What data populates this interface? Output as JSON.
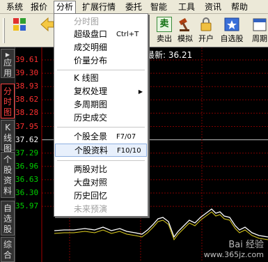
{
  "menubar": {
    "items": [
      "系统",
      "报价",
      "分析",
      "扩展行情",
      "委托",
      "智能",
      "工具",
      "资讯",
      "帮助"
    ]
  },
  "toolbar": {
    "sell_label": "卖出",
    "simulate_label": "模拟",
    "open_account_label": "开户",
    "watchlist_label": "自选股",
    "partial_label": "周期",
    "buy_glyph": "卖"
  },
  "sidetabs": {
    "apps": "应用",
    "timeshare": "分时图",
    "kline": "K线图",
    "stock_info": "个股资料",
    "watchlist": "自选股",
    "composite": "综合"
  },
  "chart": {
    "latest_text": "最新: 36.21",
    "prices": [
      "39.61",
      "39.30",
      "38.93",
      "38.62",
      "38.28",
      "37.95",
      "37.62",
      "37.29",
      "36.96",
      "36.63",
      "36.30",
      "35.97"
    ],
    "prev_close": "37.62",
    "colors": {
      "up": "#ff3030",
      "flat": "#ffffff",
      "down": "#00d000",
      "grid": "#800000"
    }
  },
  "dropdown": {
    "items": [
      {
        "label": "分时图",
        "shortcut": "",
        "disabled": true
      },
      {
        "label": "超级盘口",
        "shortcut": "Ctrl+T"
      },
      {
        "label": "成交明细",
        "shortcut": ""
      },
      {
        "label": "价量分布",
        "shortcut": ""
      },
      {
        "label": "K 线图",
        "shortcut": ""
      },
      {
        "label": "复权处理",
        "shortcut": "",
        "submenu": true
      },
      {
        "label": "多周期图",
        "shortcut": ""
      },
      {
        "label": "历史成交",
        "shortcut": ""
      },
      {
        "label": "个股全景",
        "shortcut": "F7/07"
      },
      {
        "label": "个股资料",
        "shortcut": "F10/10",
        "highlighted": true
      },
      {
        "label": "两股对比",
        "shortcut": ""
      },
      {
        "label": "大盘对照",
        "shortcut": ""
      },
      {
        "label": "历史回忆",
        "shortcut": ""
      },
      {
        "label": "未来预演",
        "shortcut": "",
        "disabled": true
      }
    ]
  },
  "watermark": {
    "brand": "Bai 经验",
    "url": "www.365jz.com"
  }
}
